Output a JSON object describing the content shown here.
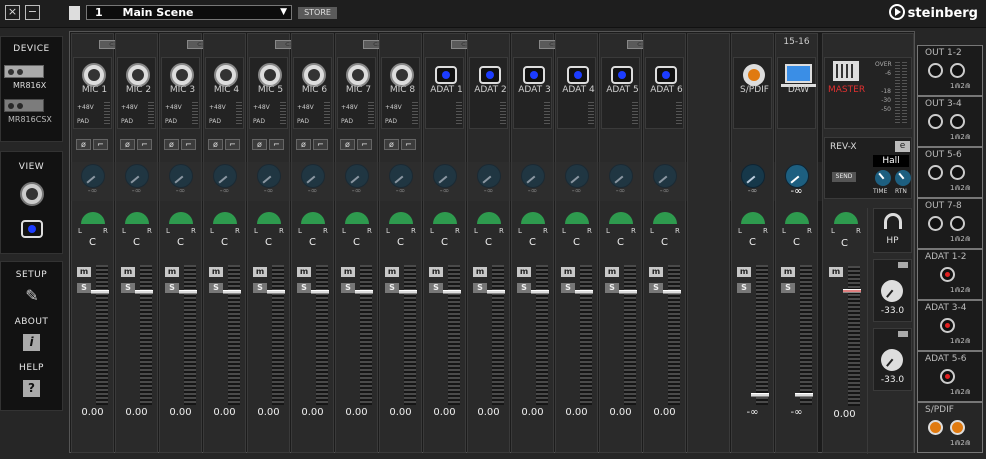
{
  "window": {
    "close": "×",
    "minimize": "−"
  },
  "scene": {
    "number": "1",
    "name": "Main Scene",
    "store_label": "STORE"
  },
  "brand": "steinberg",
  "left_panel": {
    "device_title": "DEVICE",
    "devices": [
      "MR816X",
      "MR816CSX"
    ],
    "view_title": "VIEW",
    "setup_label": "SETUP",
    "about_label": "ABOUT",
    "help_label": "HELP"
  },
  "channels": [
    {
      "name": "MIC 1",
      "type": "mic",
      "send": "-∞",
      "pan": "C",
      "fader": "0.00"
    },
    {
      "name": "MIC 2",
      "type": "mic",
      "send": "-∞",
      "pan": "C",
      "fader": "0.00"
    },
    {
      "name": "MIC 3",
      "type": "mic",
      "send": "-∞",
      "pan": "C",
      "fader": "0.00"
    },
    {
      "name": "MIC 4",
      "type": "mic",
      "send": "-∞",
      "pan": "C",
      "fader": "0.00"
    },
    {
      "name": "MIC 5",
      "type": "mic",
      "send": "-∞",
      "pan": "C",
      "fader": "0.00"
    },
    {
      "name": "MIC 6",
      "type": "mic",
      "send": "-∞",
      "pan": "C",
      "fader": "0.00"
    },
    {
      "name": "MIC 7",
      "type": "mic",
      "send": "-∞",
      "pan": "C",
      "fader": "0.00"
    },
    {
      "name": "MIC 8",
      "type": "mic",
      "send": "-∞",
      "pan": "C",
      "fader": "0.00"
    },
    {
      "name": "ADAT 1",
      "type": "adat",
      "send": "-∞",
      "pan": "C",
      "fader": "0.00"
    },
    {
      "name": "ADAT 2",
      "type": "adat",
      "send": "-∞",
      "pan": "C",
      "fader": "0.00"
    },
    {
      "name": "ADAT 3",
      "type": "adat",
      "send": "-∞",
      "pan": "C",
      "fader": "0.00"
    },
    {
      "name": "ADAT 4",
      "type": "adat",
      "send": "-∞",
      "pan": "C",
      "fader": "0.00"
    },
    {
      "name": "ADAT 5",
      "type": "adat",
      "send": "-∞",
      "pan": "C",
      "fader": "0.00"
    },
    {
      "name": "ADAT 6",
      "type": "adat",
      "send": "-∞",
      "pan": "C",
      "fader": "0.00"
    }
  ],
  "mic_labels": {
    "phantom": "+48V",
    "pad": "PAD",
    "link": "⊂⊃"
  },
  "spdif": {
    "name": "S/PDIF",
    "send": "-∞",
    "pan": "C",
    "fader": "-∞"
  },
  "daw": {
    "name": "DAW",
    "tag": "15-16",
    "send": "-∞",
    "pan": "C",
    "fader": "-∞"
  },
  "master": {
    "name": "MASTER",
    "meter_labels": [
      "OVER",
      "-6",
      "-18",
      "-30",
      "-50"
    ],
    "pan": "C",
    "fader": "0.00",
    "rev_title": "REV-X",
    "rev_edit": "e",
    "rev_type": "Hall",
    "send_label": "SEND",
    "time_label": "TIME",
    "rtn_label": "RTN"
  },
  "hp": {
    "label": "HP",
    "values": [
      "-33.0",
      "-33.0"
    ]
  },
  "outputs": [
    {
      "name": "OUT 1-2",
      "style": "plain"
    },
    {
      "name": "OUT 3-4",
      "style": "plain"
    },
    {
      "name": "OUT 5-6",
      "style": "plain"
    },
    {
      "name": "OUT 7-8",
      "style": "plain"
    },
    {
      "name": "ADAT 1-2",
      "style": "red"
    },
    {
      "name": "ADAT 3-4",
      "style": "red"
    },
    {
      "name": "ADAT 5-6",
      "style": "red"
    },
    {
      "name": "S/PDIF",
      "style": "rca"
    }
  ],
  "hp_icon_text": "1⋒2⋒",
  "labels": {
    "mute": "m",
    "solo": "S",
    "L": "L",
    "R": "R"
  },
  "colors": {
    "accent_blue": "#1c3cff",
    "pan_green": "#2e9a4e",
    "master_red": "#e03030"
  }
}
